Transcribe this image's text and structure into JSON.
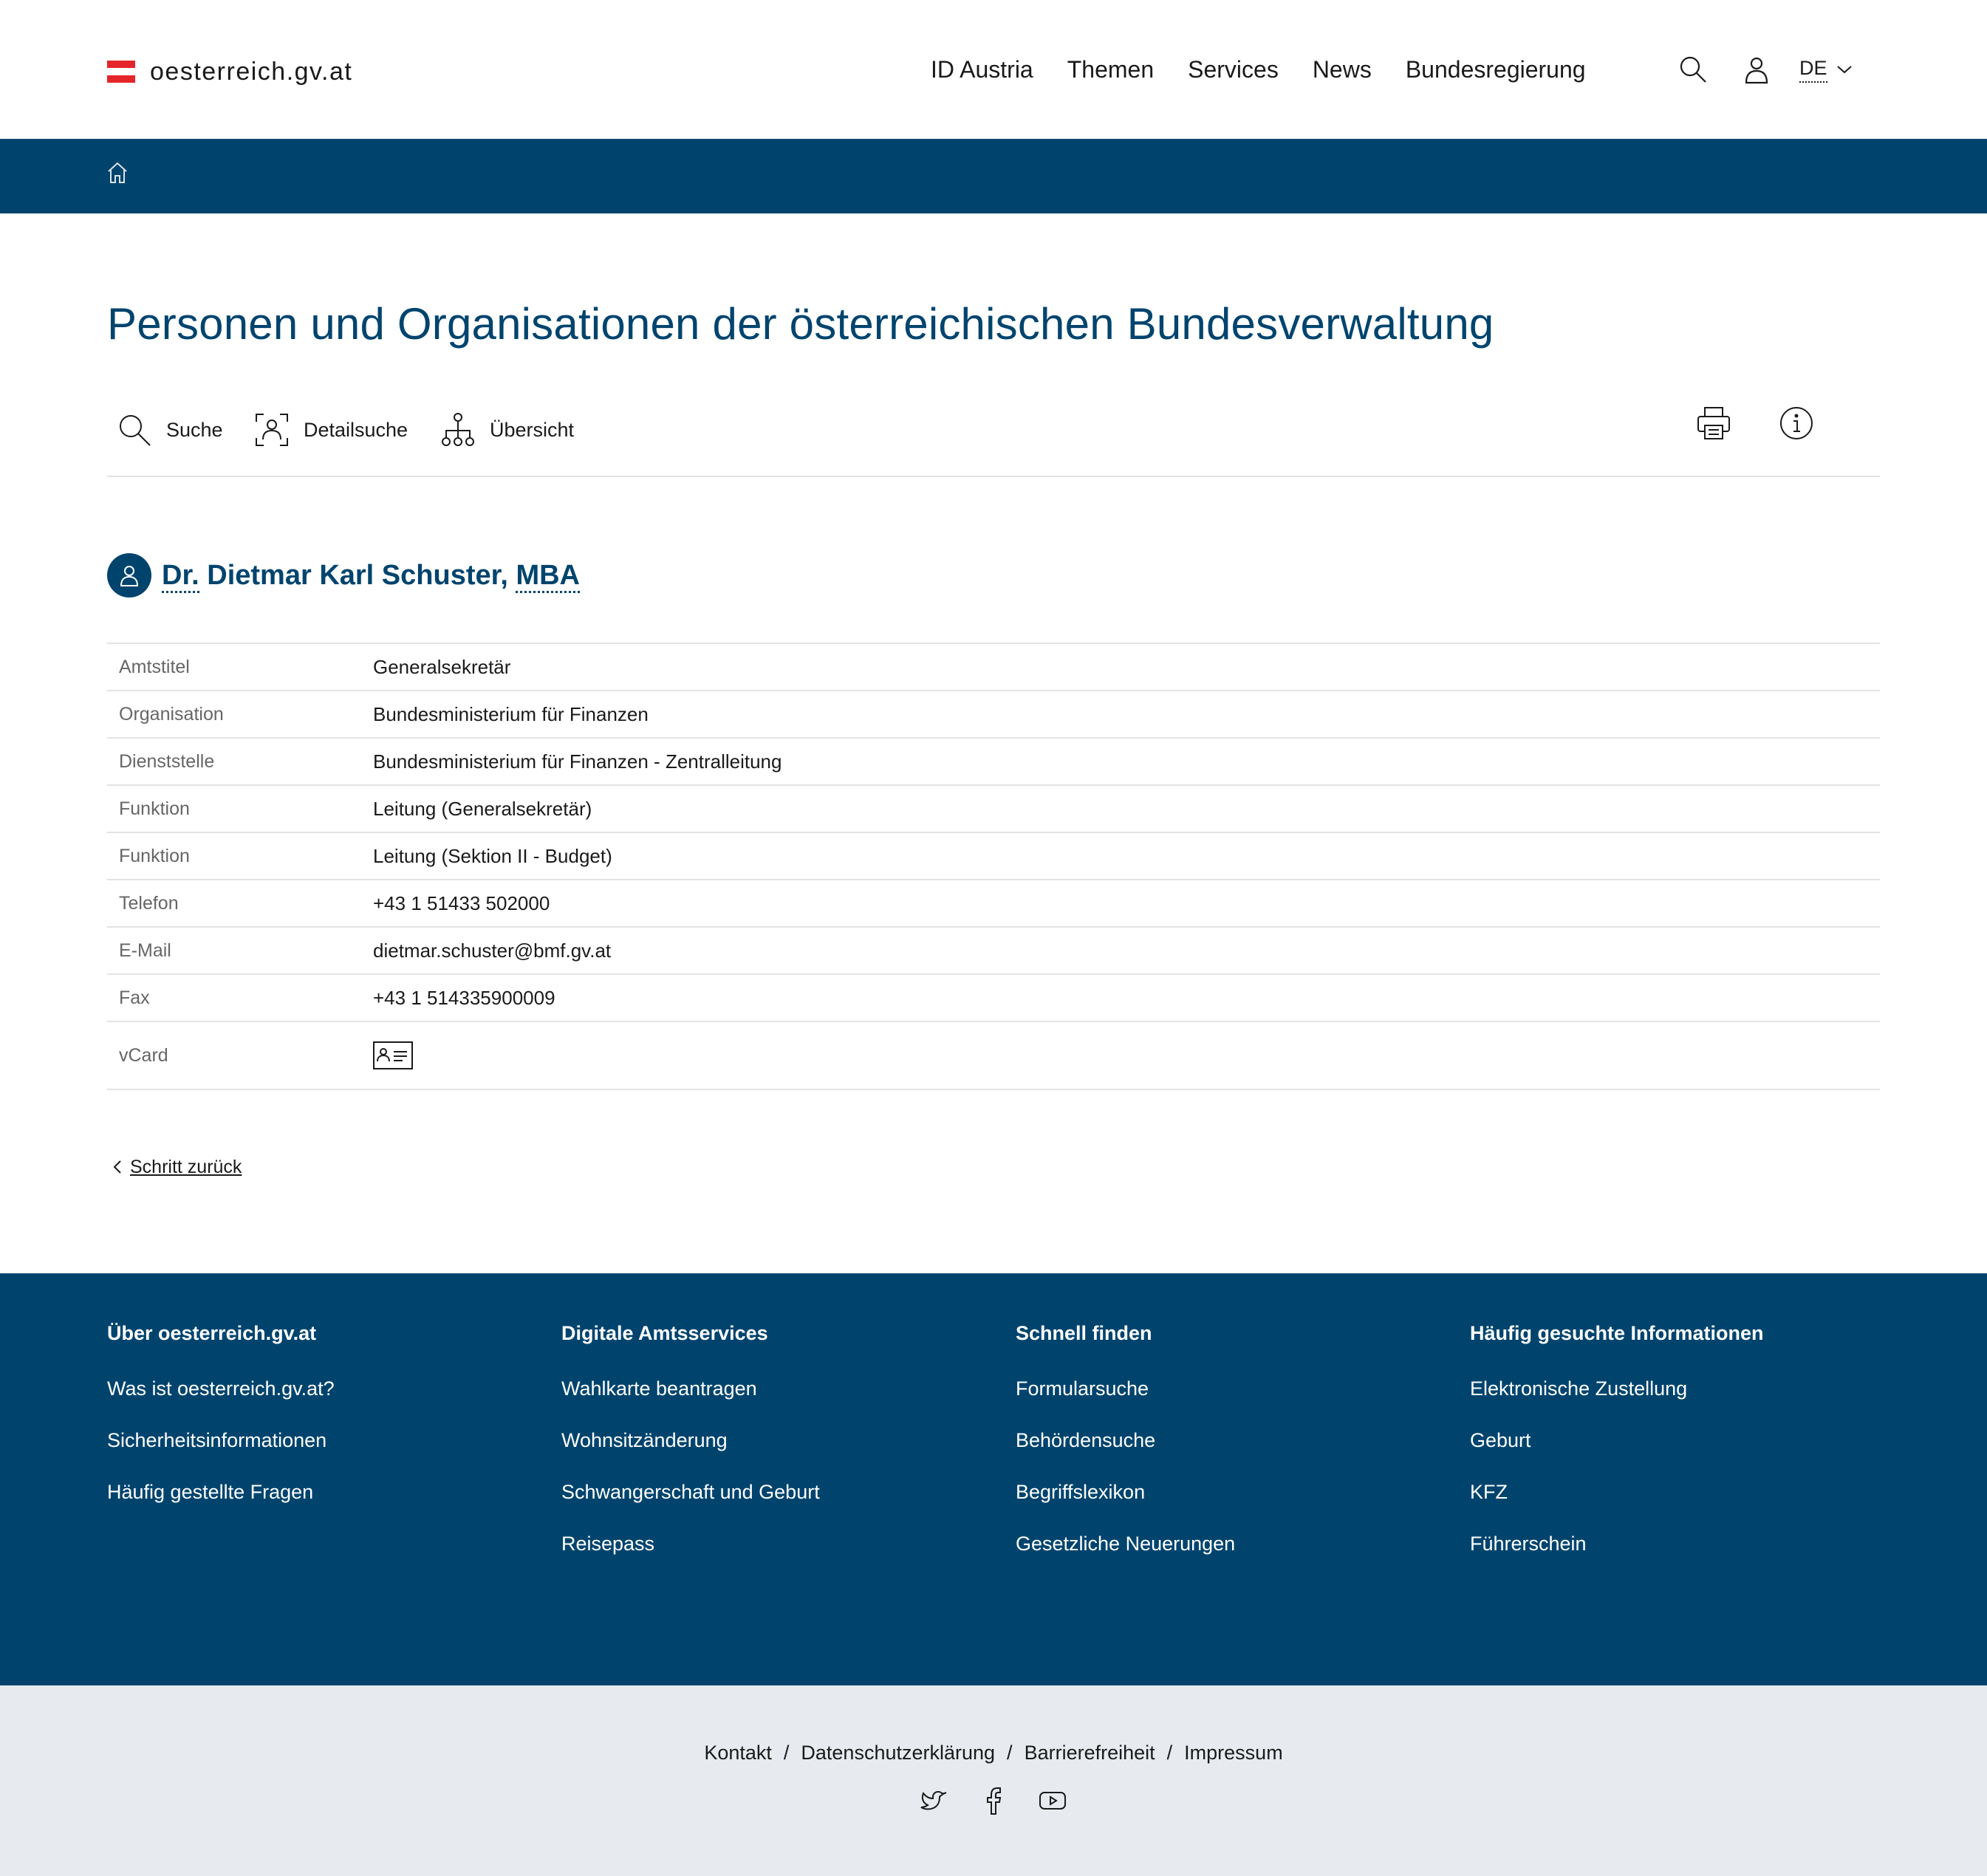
{
  "site": {
    "logo_text": "oesterreich.gv.at",
    "nav": [
      "ID Austria",
      "Themen",
      "Services",
      "News",
      "Bundesregierung"
    ],
    "lang": "DE"
  },
  "page": {
    "title": "Personen und Organisationen der österreichischen Bundesverwaltung",
    "toolbar": {
      "search": "Suche",
      "detail_search": "Detailsuche",
      "overview": "Übersicht"
    }
  },
  "person": {
    "prefix": "Dr.",
    "name": " Dietmar Karl Schuster, ",
    "suffix": "MBA",
    "rows": [
      {
        "label": "Amtstitel",
        "value": "Generalsekretär"
      },
      {
        "label": "Organisation",
        "link": "Bundesministerium für Finanzen"
      },
      {
        "label": "Dienststelle",
        "value": "Bundesministerium für Finanzen - Zentralleitung"
      },
      {
        "label": "Funktion",
        "pre": "Leitung (",
        "link": "Generalsekretär",
        "post": ")"
      },
      {
        "label": "Funktion",
        "pre": "Leitung (",
        "link": "Sektion II - Budget",
        "post": ")"
      },
      {
        "label": "Telefon",
        "link": "+43 1 51433 502000"
      },
      {
        "label": "E-Mail",
        "link": "dietmar.schuster@bmf.gv.at"
      },
      {
        "label": "Fax",
        "link": "+43 1 514335900009"
      },
      {
        "label": "vCard"
      }
    ]
  },
  "back_link": "Schritt zurück",
  "footer": {
    "columns": [
      {
        "title": "Über oesterreich.gv.at",
        "links": [
          "Was ist oesterreich.gv.at?",
          "Sicherheitsinformationen",
          "Häufig gestellte Fragen"
        ]
      },
      {
        "title": "Digitale Amtsservices",
        "links": [
          "Wahlkarte beantragen",
          "Wohnsitzänderung",
          "Schwangerschaft und Geburt",
          "Reisepass"
        ]
      },
      {
        "title": "Schnell finden",
        "links": [
          "Formularsuche",
          "Behördensuche",
          "Begriffslexikon",
          "Gesetzliche Neuerungen"
        ]
      },
      {
        "title": "Häufig gesuchte Informationen",
        "links": [
          "Elektronische Zustellung",
          "Geburt",
          "KFZ",
          "Führerschein"
        ]
      }
    ],
    "legal": [
      "Kontakt",
      "Datenschutzerklärung",
      "Barrierefreiheit",
      "Impressum"
    ],
    "separator": "/"
  },
  "colors": {
    "brand_blue": "#00446e",
    "austria_red": "#e4262b",
    "subfooter_bg": "#e7ebef"
  }
}
